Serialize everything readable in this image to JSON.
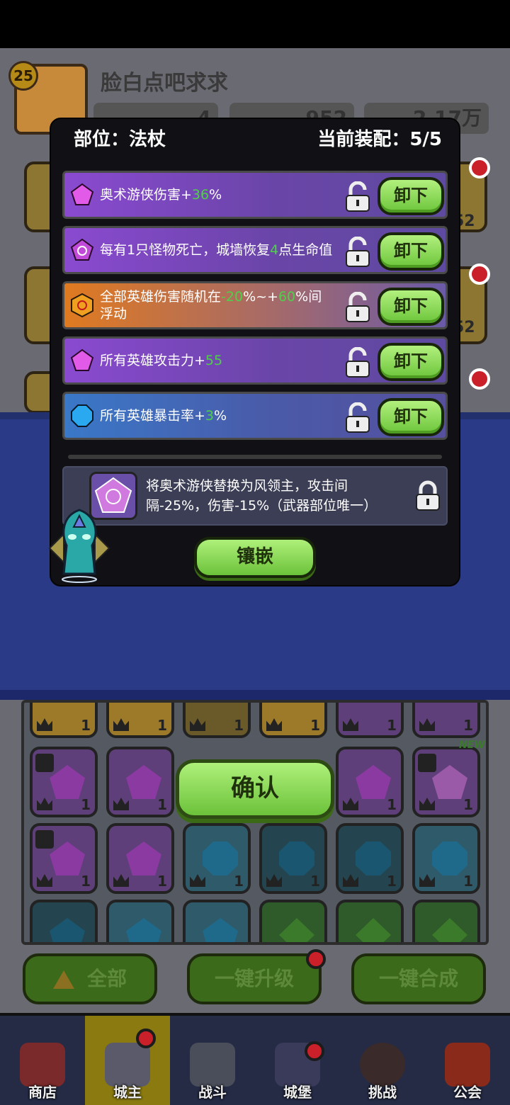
{
  "profile": {
    "level": "25",
    "name": "脸白点吧求求",
    "resources": [
      {
        "icon": "gold-gem-icon",
        "value": "4"
      },
      {
        "icon": "purple-crystal-icon",
        "value": "952"
      },
      {
        "icon": "coin-icon",
        "value": "2.17万"
      }
    ]
  },
  "side_counts": [
    "52",
    "52"
  ],
  "modal": {
    "part_label": "部位：法杖",
    "equip_label": "当前装配：5/5",
    "rows": [
      {
        "gem": "purple-pentagon-gem-icon",
        "pre": "奥术游侠伤害+",
        "g1": "36",
        "mid": "%",
        "g2": "",
        "post": "",
        "button": "卸下"
      },
      {
        "gem": "purple-swirl-gem-icon",
        "pre": "每有1只怪物死亡，城墙恢复",
        "g1": "4",
        "mid": "点生命值",
        "g2": "",
        "post": "",
        "button": "卸下"
      },
      {
        "gem": "orange-hexagon-gem-icon",
        "pre": "全部英雄伤害随机在",
        "g1": "-20",
        "mid": "%~+",
        "g2": "60",
        "post": "%间浮动",
        "button": "卸下"
      },
      {
        "gem": "purple-pentagon-gem-icon",
        "pre": "所有英雄攻击力+",
        "g1": "55",
        "mid": "",
        "g2": "",
        "post": "",
        "button": "卸下"
      },
      {
        "gem": "blue-octagon-gem-icon",
        "pre": "所有英雄暴击率+",
        "g1": "3",
        "mid": "%",
        "g2": "",
        "post": "",
        "button": "卸下"
      }
    ],
    "skill_text": "将奥术游侠替换为风领主，攻击间隔-25%，伤害-15%（武器部位唯一）",
    "inlay_button": "镶嵌"
  },
  "inventory": {
    "new_tag": "NEW",
    "count_label": "1"
  },
  "confirm_button": "确认",
  "bottom_buttons": {
    "all": "全部",
    "upgrade": "一键升级",
    "merge": "一键合成"
  },
  "nav": [
    {
      "label": "商店",
      "icon": "shop-icon"
    },
    {
      "label": "城主",
      "icon": "lord-crown-icon"
    },
    {
      "label": "战斗",
      "icon": "swords-icon"
    },
    {
      "label": "城堡",
      "icon": "castle-icon"
    },
    {
      "label": "挑战",
      "icon": "demon-icon"
    },
    {
      "label": "公会",
      "icon": "guild-flag-icon"
    }
  ],
  "colors": {
    "green_value": "#4fd04a",
    "button_green": "#8ee05a",
    "modal_bg": "#111115"
  }
}
